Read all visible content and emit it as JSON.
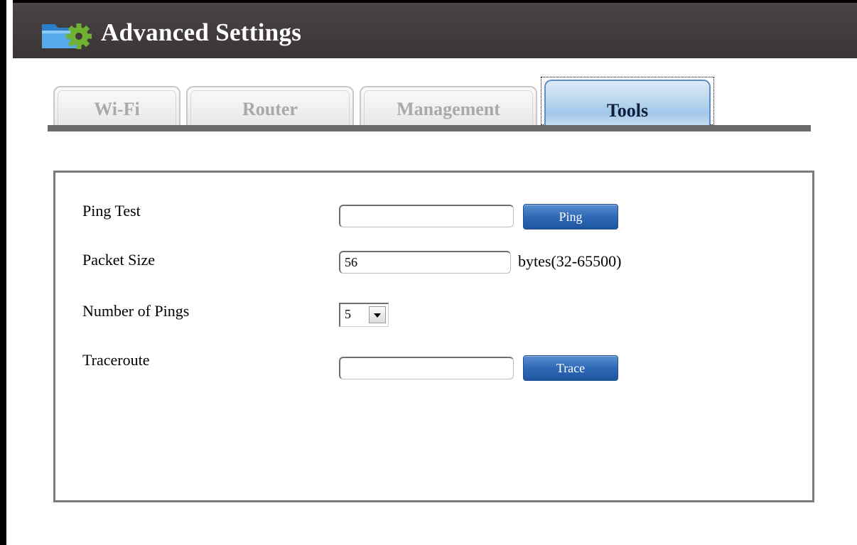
{
  "window": {
    "title": "Advanced Settings",
    "title_icon": "folder-gear-icon"
  },
  "tabs": [
    {
      "label": "Wi-Fi",
      "active": false
    },
    {
      "label": "Router",
      "active": false
    },
    {
      "label": "Management",
      "active": false
    },
    {
      "label": "Tools",
      "active": true
    }
  ],
  "tools": {
    "ping_test": {
      "label": "Ping Test",
      "value": "",
      "button_label": "Ping"
    },
    "packet_size": {
      "label": "Packet Size",
      "value": "56",
      "unit": "bytes(32-65500)"
    },
    "number_of_pings": {
      "label": "Number of Pings",
      "value": "5"
    },
    "traceroute": {
      "label": "Traceroute",
      "value": "",
      "button_label": "Trace"
    }
  },
  "colors": {
    "title_bar": "#3f3a39",
    "button": "#2f69b6",
    "active_tab": "#b9d6ef"
  }
}
